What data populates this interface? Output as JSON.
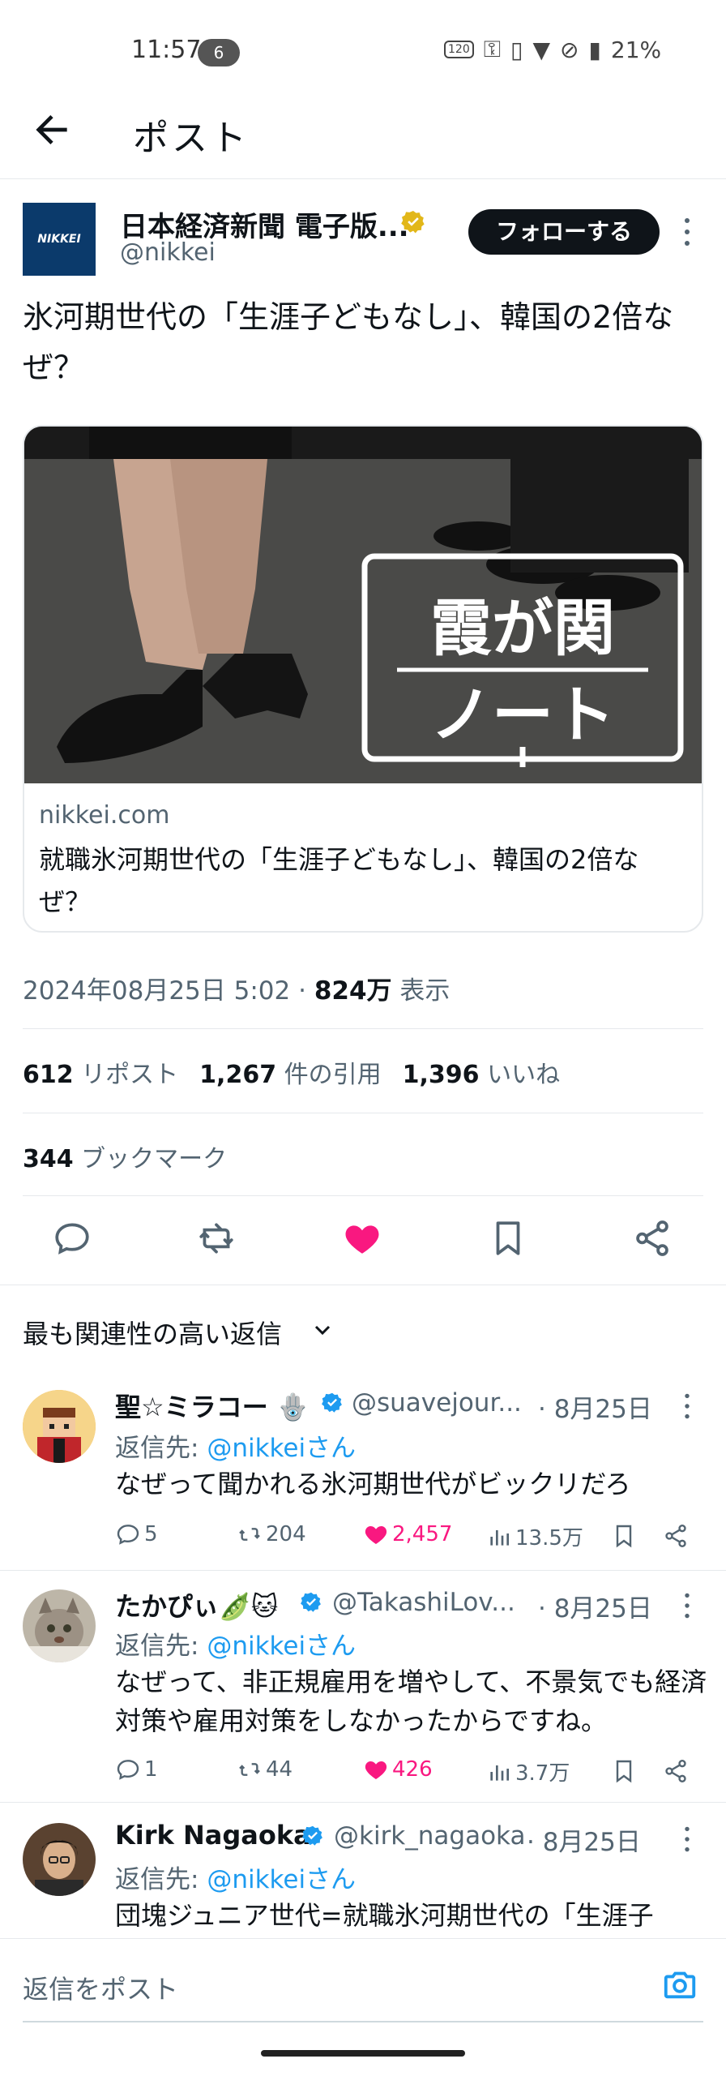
{
  "status_bar": {
    "time": "11:57",
    "notification_count": "6",
    "refresh_label": "120",
    "battery": "21%"
  },
  "header": {
    "title": "ポスト"
  },
  "post": {
    "author_name": "日本経済新聞 電子版...",
    "author_handle": "@nikkei",
    "avatar_text": "NIKKEI",
    "follow_label": "フォローする",
    "text": "氷河期世代の「生涯子どもなし」、韓国の2倍なぜ？",
    "card": {
      "image_text_line1": "霞が関",
      "image_text_line2": "ノート",
      "domain": "nikkei.com",
      "title": "就職氷河期世代の「生涯子どもなし」、韓国の2倍なぜ？"
    },
    "timestamp": "2024年08月25日 5:02",
    "views_count": "824万",
    "views_label": "表示",
    "reposts_count": "612",
    "reposts_label": "リポスト",
    "quotes_count": "1,267",
    "quotes_label": "件の引用",
    "likes_count": "1,396",
    "likes_label": "いいね",
    "bookmarks_count": "344",
    "bookmarks_label": "ブックマーク",
    "liked": true
  },
  "replies_sort": {
    "label": "最も関連性の高い返信"
  },
  "replies": [
    {
      "name": "聖☆ミラコー",
      "handle": "@suavejour...",
      "date": "· 8月25日",
      "reply_prefix": "返信先: ",
      "reply_to": "@nikkeiさん",
      "text": "なぜって聞かれる氷河期世代がビックリだろ",
      "comments": "5",
      "reposts": "204",
      "likes": "2,457",
      "views": "13.5万",
      "liked": true
    },
    {
      "name": "たかぴぃ",
      "handle": "@TakashiLov...",
      "date": "· 8月25日",
      "reply_prefix": "返信先: ",
      "reply_to": "@nikkeiさん",
      "text": "なぜって、非正規雇用を増やして、不景気でも経済対策や雇用対策をしなかったからですね。",
      "comments": "1",
      "reposts": "44",
      "likes": "426",
      "views": "3.7万",
      "liked": true
    },
    {
      "name": "Kirk Nagaoka",
      "handle": "@kirk_nagaoka",
      "date": "· 8月25日",
      "reply_prefix": "返信先: ",
      "reply_to": "@nikkeiさん",
      "text": "団塊ジュニア世代=就職氷河期世代の「生涯子"
    }
  ],
  "composer": {
    "placeholder": "返信をポスト"
  },
  "colors": {
    "accent": "#1d9bf0",
    "like": "#f91880",
    "text": "#0f1419",
    "secondary": "#536471",
    "verified_gold": "#e2b719"
  }
}
